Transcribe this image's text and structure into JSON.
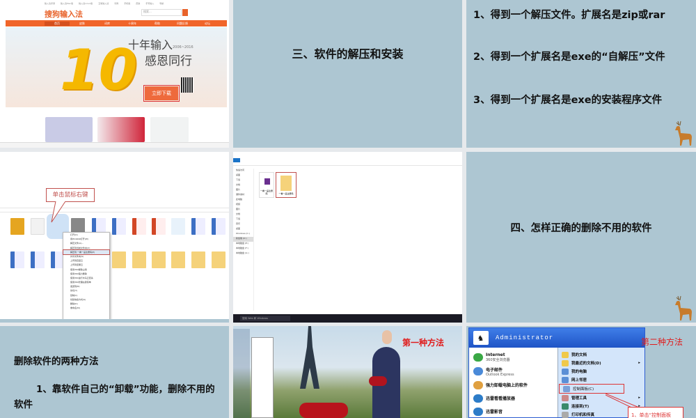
{
  "slides": [
    {
      "number": 1,
      "type": "screenshot",
      "topbar_links": [
        "输入法评测",
        "输入法Mac版",
        "输入法Linux版",
        "五笔输入法",
        "词库",
        "手机版",
        "皮肤",
        "手写输入",
        "导航"
      ],
      "logo": "搜狗输入法",
      "search_placeholder": "搜索...",
      "nav": [
        "首页",
        "皮肤",
        "词库",
        "十周年",
        "帮助",
        "问题反馈",
        "论坛"
      ],
      "hero_line1": "十年输入",
      "hero_years": "2006~2016",
      "hero_line2": "感恩同行",
      "hero_number": "10",
      "download_button": "立即下载"
    },
    {
      "number": 2,
      "title": "三、软件的解压和安装"
    },
    {
      "number": 3,
      "items": [
        "1、得到一个解压文件。扩展名是zip或rar",
        "2、得到一个扩展名是exe的“自解压”文件",
        "3、得到一个扩展名是exe的安装程序文件"
      ]
    },
    {
      "number": 4,
      "type": "screenshot",
      "callout": "单击鼠标右键",
      "context_menu": [
        "打开(O)",
        "用WinRAR打开(W)",
        "解压文件(A)...",
        "解压到当前文件夹(X)",
        "解压到 一看一品注册码(E)",
        "共享文件夹(S)",
        "上传到百度云",
        "上传到坚果云",
        "使用360解除占用",
        "使用360强力删除",
        "使用360进行木马云查杀",
        "使用360管理右键菜单",
        "发送到(N)",
        "剪切(T)",
        "复制(C)",
        "创建快捷方式(S)",
        "删除(D)",
        "重命名(M)"
      ]
    },
    {
      "number": 5,
      "type": "screenshot",
      "nav_items": [
        "快速访问",
        "桌面",
        "下载",
        "文档",
        "图片",
        "课件素材",
        "此电脑",
        "视频",
        "图片",
        "文档",
        "下载",
        "音乐",
        "桌面",
        "Windows (C:)",
        "新加卷 (D:)",
        "本地磁盘 (E:)",
        "本地磁盘 (F:)",
        "本地磁盘 (G:)"
      ],
      "files": [
        "一看一品注册码",
        "一看一品注册码"
      ],
      "taskbar_search": "搜索 Web 和 Windows"
    },
    {
      "number": 6,
      "title": "四、怎样正确的删除不用的软件"
    },
    {
      "number": 7,
      "heading": "删除软件的两种方法",
      "item": "1、靠软件自己的“卸载”功能，删除不用的软件"
    },
    {
      "number": 8,
      "type": "screenshot",
      "label": "第一种方法"
    },
    {
      "number": 9,
      "type": "screenshot",
      "label": "第二种方法",
      "user": "Administrator",
      "left_items": [
        {
          "title": "Internet",
          "sub": "360安全浏览器"
        },
        {
          "title": "电子邮件",
          "sub": "Outlook Express"
        },
        {
          "title": "强力卸载电脑上的软件",
          "sub": ""
        },
        {
          "title": "迅雷看看播放器",
          "sub": ""
        },
        {
          "title": "迅雷影音",
          "sub": ""
        }
      ],
      "right_items": [
        "我的文档",
        "我最近的文档(D)",
        "我的电脑",
        "网上邻居",
        "控制面板(C)",
        "管理工具",
        "连接到(T)",
        "打印机和传真"
      ],
      "callout": "1、单击“控制面板"
    }
  ],
  "colors": {
    "slide_bg": "#adc6d2",
    "accent_red": "#e01b1b",
    "sogou_orange": "#f0652a"
  }
}
